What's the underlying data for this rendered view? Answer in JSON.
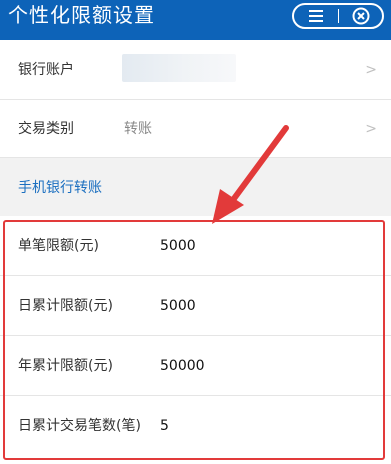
{
  "header": {
    "title": "个性化限额设置",
    "menu_icon": "menu-icon",
    "close_icon": "close-circle-icon"
  },
  "rows": {
    "account": {
      "label": "银行账户",
      "chevron": ">"
    },
    "trade_type": {
      "label": "交易类别",
      "value": "转账",
      "chevron": ">"
    }
  },
  "section": {
    "title": "手机银行转账"
  },
  "limits": [
    {
      "label": "单笔限额(元)",
      "value": "5000"
    },
    {
      "label": "日累计限额(元)",
      "value": "5000"
    },
    {
      "label": "年累计限额(元)",
      "value": "50000"
    },
    {
      "label": "日累计交易笔数(笔)",
      "value": "5"
    }
  ],
  "colors": {
    "header_bg": "#0d63b8",
    "section_title": "#1b6fc0",
    "annotation_red": "#e23a3a"
  }
}
